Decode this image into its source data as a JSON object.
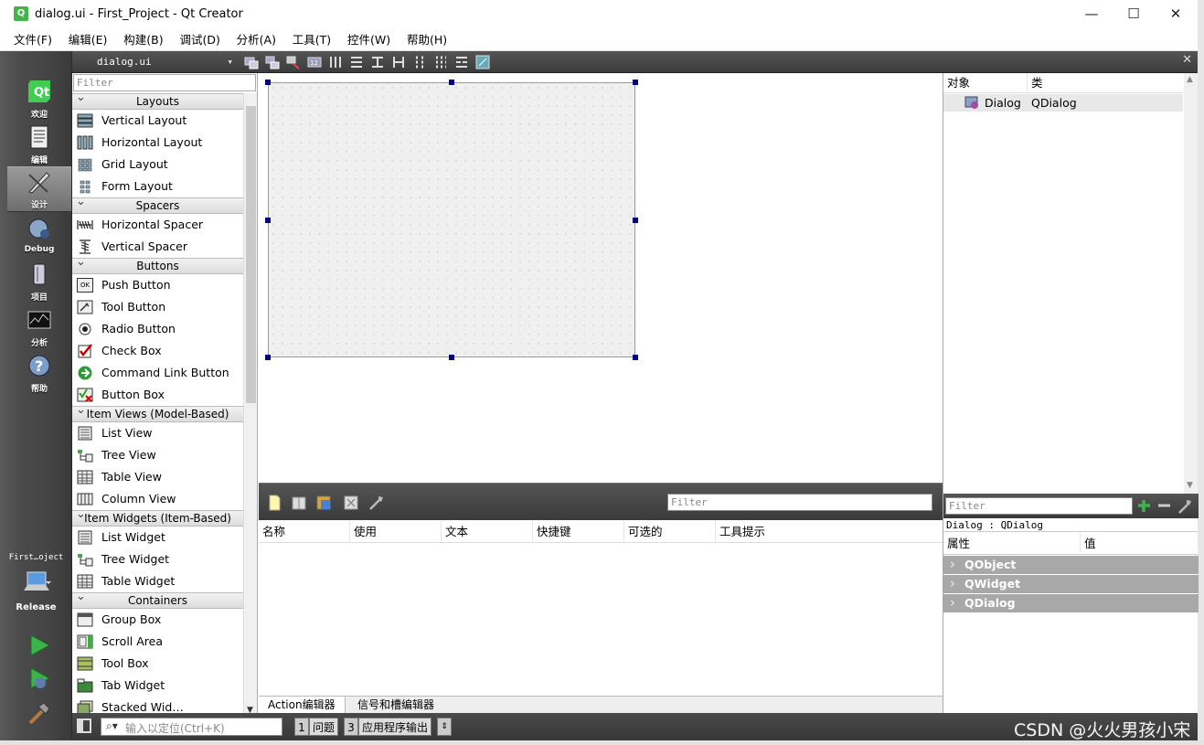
{
  "window": {
    "title": "dialog.ui - First_Project - Qt Creator",
    "minimize": "—",
    "maximize": "☐",
    "close": "✕"
  },
  "menu": [
    "文件(F)",
    "编辑(E)",
    "构建(B)",
    "调试(D)",
    "分析(A)",
    "工具(T)",
    "控件(W)",
    "帮助(H)"
  ],
  "modes": [
    {
      "label": "欢迎",
      "icon": "qt-logo-icon"
    },
    {
      "label": "编辑",
      "icon": "edit-document-icon"
    },
    {
      "label": "设计",
      "icon": "design-pen-icon",
      "active": true
    },
    {
      "label": "Debug",
      "icon": "debug-icon"
    },
    {
      "label": "项目",
      "icon": "project-wrench-icon"
    },
    {
      "label": "分析",
      "icon": "analyze-graph-icon"
    },
    {
      "label": "帮助",
      "icon": "help-icon"
    }
  ],
  "kit": {
    "project": "First…oject",
    "config": "Release"
  },
  "editor": {
    "file": "dialog.ui",
    "close": "✕"
  },
  "widgetbox": {
    "filter_placeholder": "Filter",
    "categories": {
      "layouts": "Layouts",
      "spacers": "Spacers",
      "buttons": "Buttons",
      "item_views": "Item Views (Model-Based)",
      "item_widgets": "Item Widgets (Item-Based)",
      "containers": "Containers"
    },
    "items": {
      "vertical_layout": "Vertical Layout",
      "horizontal_layout": "Horizontal Layout",
      "grid_layout": "Grid Layout",
      "form_layout": "Form Layout",
      "horizontal_spacer": "Horizontal Spacer",
      "vertical_spacer": "Vertical Spacer",
      "push_button": "Push Button",
      "tool_button": "Tool Button",
      "radio_button": "Radio Button",
      "check_box": "Check Box",
      "command_link_button": "Command Link Button",
      "button_box": "Button Box",
      "list_view": "List View",
      "tree_view": "Tree View",
      "table_view": "Table View",
      "column_view": "Column View",
      "list_widget": "List Widget",
      "tree_widget": "Tree Widget",
      "table_widget": "Table Widget",
      "group_box": "Group Box",
      "scroll_area": "Scroll Area",
      "tool_box": "Tool Box",
      "tab_widget": "Tab Widget",
      "stacked_widget": "Stacked Wid…"
    },
    "icon_ok": "OK"
  },
  "action_editor": {
    "filter_placeholder": "Filter",
    "columns": [
      "名称",
      "使用",
      "文本",
      "快捷键",
      "可选的",
      "工具提示"
    ],
    "tabs": [
      "Action编辑器",
      "信号和槽编辑器"
    ]
  },
  "object_inspector": {
    "columns": [
      "对象",
      "类"
    ],
    "rows": [
      {
        "object": "Dialog",
        "class": "QDialog"
      }
    ]
  },
  "property_editor": {
    "filter_placeholder": "Filter",
    "current": "Dialog : QDialog",
    "columns": [
      "属性",
      "值"
    ],
    "groups": [
      "QObject",
      "QWidget",
      "QDialog"
    ]
  },
  "statusbar": {
    "locator_placeholder": "输入以定位(Ctrl+K)",
    "panes": [
      {
        "num": "1",
        "label": "问题"
      },
      {
        "num": "3",
        "label": "应用程序输出"
      }
    ]
  },
  "watermark": "CSDN @火火男孩小宋",
  "colors": {
    "handle": "#000080",
    "sidebar": "#4a4a4a",
    "run_green": "#3ab54a"
  }
}
